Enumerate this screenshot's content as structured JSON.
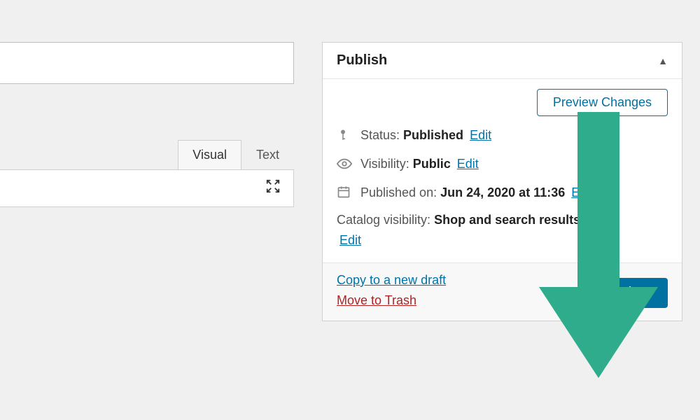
{
  "editor": {
    "title_value": "",
    "tabs": {
      "visual": "Visual",
      "text": "Text"
    }
  },
  "publish": {
    "heading": "Publish",
    "preview_button": "Preview Changes",
    "status": {
      "label": "Status:",
      "value": "Published",
      "edit": "Edit"
    },
    "visibility": {
      "label": "Visibility:",
      "value": "Public",
      "edit": "Edit"
    },
    "published_on": {
      "label": "Published on:",
      "value": "Jun 24, 2020 at 11:36",
      "edit": "Edit"
    },
    "catalog": {
      "label": "Catalog visibility:",
      "value": "Shop and search results",
      "edit": "Edit"
    },
    "copy_link": "Copy to a new draft",
    "trash_link": "Move to Trash",
    "update_button": "Update"
  },
  "colors": {
    "accent": "#0071a1",
    "arrow": "#2fac8c"
  }
}
